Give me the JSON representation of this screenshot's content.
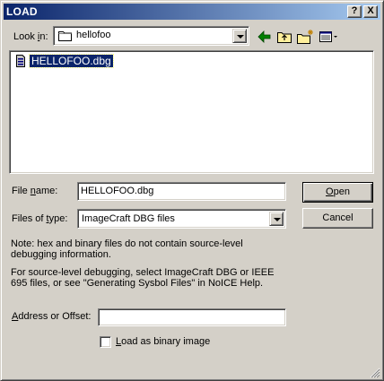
{
  "window": {
    "title": "LOAD"
  },
  "titlebar_buttons": {
    "help": "?",
    "close": "X"
  },
  "look_in": {
    "label_pre": "Look ",
    "label_key": "i",
    "label_post": "n:",
    "value": "hellofoo"
  },
  "toolbar": {
    "icons": [
      "back-icon",
      "up-folder-icon",
      "new-folder-icon",
      "view-menu-icon"
    ]
  },
  "files": [
    {
      "name": "HELLOFOO.dbg",
      "selected": true
    }
  ],
  "file_name": {
    "label_pre": "File ",
    "label_key": "n",
    "label_post": "ame:",
    "value": "HELLOFOO.dbg"
  },
  "files_of_type": {
    "label_pre": "Files of ",
    "label_key": "t",
    "label_post": "ype:",
    "value": "ImageCraft DBG files"
  },
  "buttons": {
    "open_key": "O",
    "open_rest": "pen",
    "cancel": "Cancel"
  },
  "notes": {
    "note1": "Note: hex and binary files do not contain source-level debugging information.",
    "note2": "For source-level debugging, select ImageCraft DBG or IEEE 695 files, or see \"Generating Sysbol Files\" in NoICE Help."
  },
  "address": {
    "label_key": "A",
    "label_rest": "ddress or Offset:",
    "value": ""
  },
  "binary": {
    "label_key": "L",
    "label_rest": "oad as binary image",
    "checked": false
  },
  "colors": {
    "titlebar_start": "#0a246a",
    "titlebar_end": "#a6caf0",
    "face": "#d4d0c8",
    "selection": "#0a246a"
  }
}
